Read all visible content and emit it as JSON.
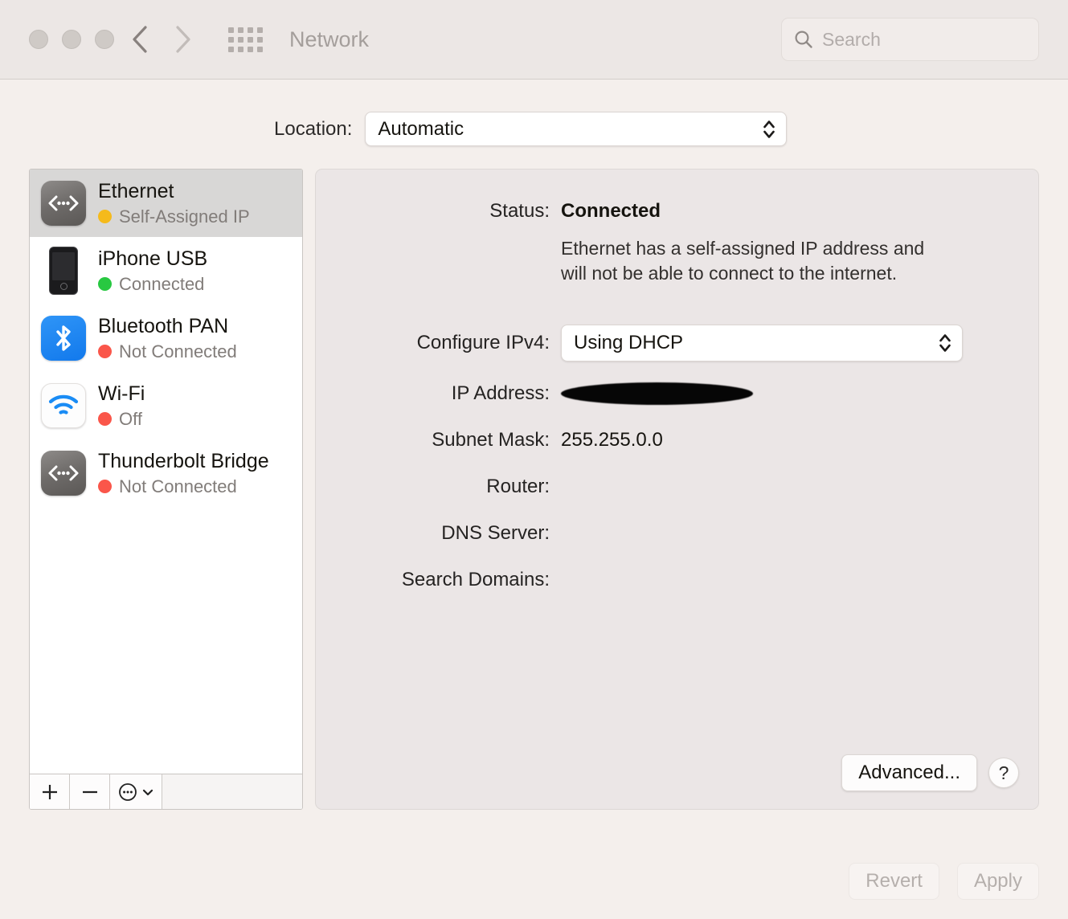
{
  "window": {
    "title": "Network",
    "traffic_lights": [
      "close",
      "minimize",
      "zoom"
    ],
    "back_icon": "chevron-left-icon",
    "forward_icon": "chevron-right-icon",
    "grid_icon": "show-all-grid-icon"
  },
  "search": {
    "placeholder": "Search",
    "value": "",
    "icon": "search-icon"
  },
  "location": {
    "label": "Location:",
    "value": "Automatic",
    "options": [
      "Automatic"
    ]
  },
  "services": [
    {
      "name": "Ethernet",
      "status": "Self-Assigned IP",
      "status_color": "#f5ba1b",
      "icon": "ethernet-icon",
      "selected": true
    },
    {
      "name": "iPhone USB",
      "status": "Connected",
      "status_color": "#28c841",
      "icon": "iphone-icon",
      "selected": false
    },
    {
      "name": "Bluetooth PAN",
      "status": "Not Connected",
      "status_color": "#fa564a",
      "icon": "bluetooth-icon",
      "selected": false
    },
    {
      "name": "Wi-Fi",
      "status": "Off",
      "status_color": "#fa564a",
      "icon": "wifi-icon",
      "selected": false
    },
    {
      "name": "Thunderbolt Bridge",
      "status": "Not Connected",
      "status_color": "#fa564a",
      "icon": "ethernet-icon",
      "selected": false
    }
  ],
  "service_toolbar": {
    "add_icon": "plus-icon",
    "remove_icon": "minus-icon",
    "actions_icon": "ellipsis-circle-icon",
    "actions_chevron": "chevron-down-icon"
  },
  "detail": {
    "status_label": "Status:",
    "status_value": "Connected",
    "status_note": "Ethernet has a self-assigned IP address and will not be able to connect to the internet.",
    "configure_label": "Configure IPv4:",
    "configure_value": "Using DHCP",
    "ip_label": "IP Address:",
    "ip_value": "",
    "ip_redacted": true,
    "subnet_label": "Subnet Mask:",
    "subnet_value": "255.255.0.0",
    "router_label": "Router:",
    "router_value": "",
    "dns_label": "DNS Server:",
    "dns_value": "",
    "search_domains_label": "Search Domains:",
    "search_domains_value": "",
    "advanced_label": "Advanced...",
    "help_label": "?"
  },
  "footer": {
    "revert_label": "Revert",
    "apply_label": "Apply",
    "revert_enabled": false,
    "apply_enabled": false
  }
}
